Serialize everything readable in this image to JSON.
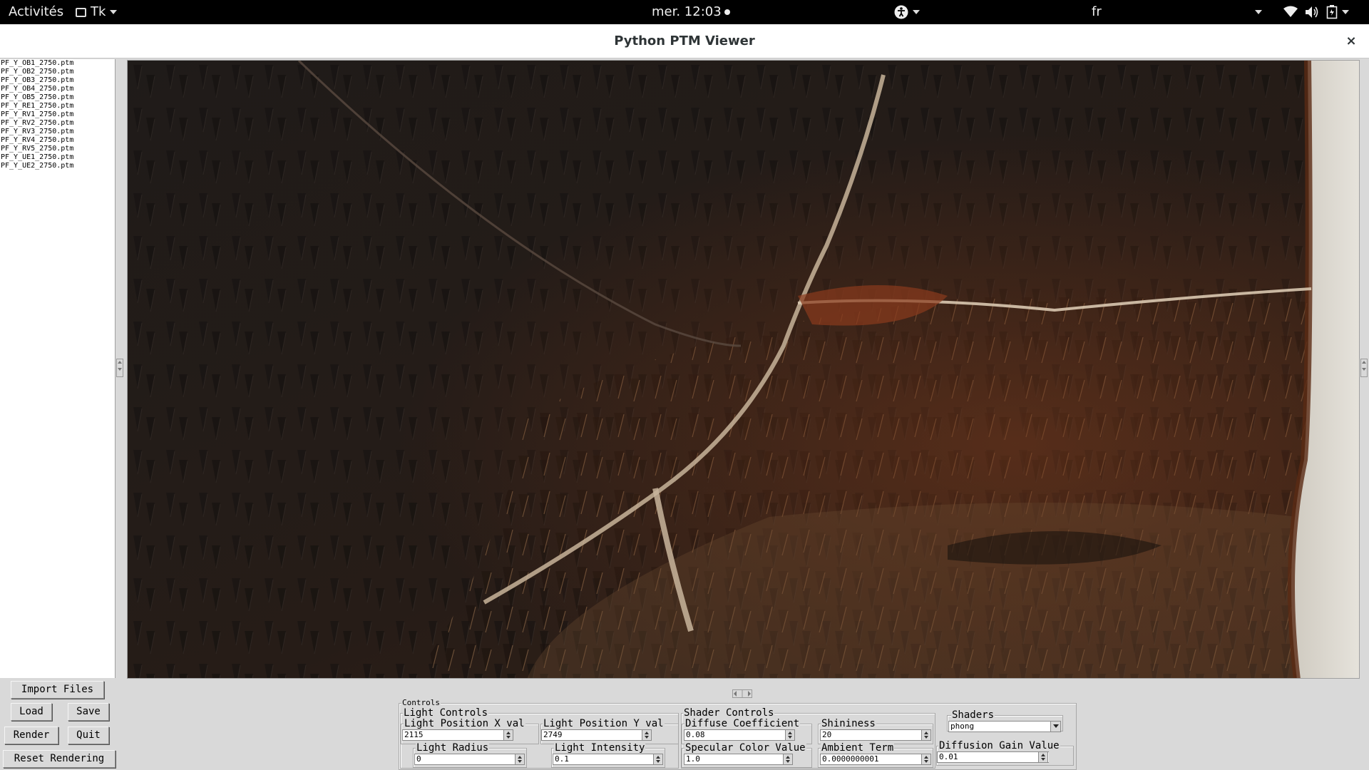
{
  "topbar": {
    "activities": "Activités",
    "app_menu": "Tk",
    "clock": "mer. 12:03",
    "language": "fr",
    "icons": [
      "accessibility-icon",
      "wifi-icon",
      "volume-icon",
      "battery-icon",
      "system-menu-chevron-icon"
    ]
  },
  "window": {
    "title": "Python PTM Viewer",
    "close_glyph": "×"
  },
  "files": [
    "PF_Y_OB1_2750.ptm",
    "PF_Y_OB2_2750.ptm",
    "PF_Y_OB3_2750.ptm",
    "PF_Y_OB4_2750.ptm",
    "PF_Y_OB5_2750.ptm",
    "PF_Y_RE1_2750.ptm",
    "PF_Y_RV1_2750.ptm",
    "PF_Y_RV2_2750.ptm",
    "PF_Y_RV3_2750.ptm",
    "PF_Y_RV4_2750.ptm",
    "PF_Y_RV5_2750.ptm",
    "PF_Y_UE1_2750.ptm",
    "PF_Y_UE2_2750.ptm"
  ],
  "buttons": {
    "import": "Import Files",
    "load": "Load",
    "save": "Save",
    "render": "Render",
    "quit": "Quit",
    "reset": "Reset Rendering"
  },
  "controls": {
    "title": "Controls",
    "light": {
      "title": "Light Controls",
      "pos_x_label": "Light Position X val",
      "pos_x_value": "2115",
      "pos_y_label": "Light Position Y val",
      "pos_y_value": "2749",
      "radius_label": "Light Radius",
      "radius_value": "0",
      "intensity_label": "Light Intensity",
      "intensity_value": "0.1"
    },
    "shader": {
      "title": "Shader Controls",
      "diffuse_label": "Diffuse Coefficient",
      "diffuse_value": "0.08",
      "shininess_label": "Shininess",
      "shininess_value": "20",
      "specular_label": "Specular Color Value",
      "specular_value": "1.0",
      "ambient_label": "Ambient Term",
      "ambient_value": "0.0000000001"
    },
    "shaders": {
      "title": "Shaders",
      "selected": "phong"
    },
    "diffusion_gain": {
      "label": "Diffusion Gain Value",
      "value": "0.01"
    }
  }
}
